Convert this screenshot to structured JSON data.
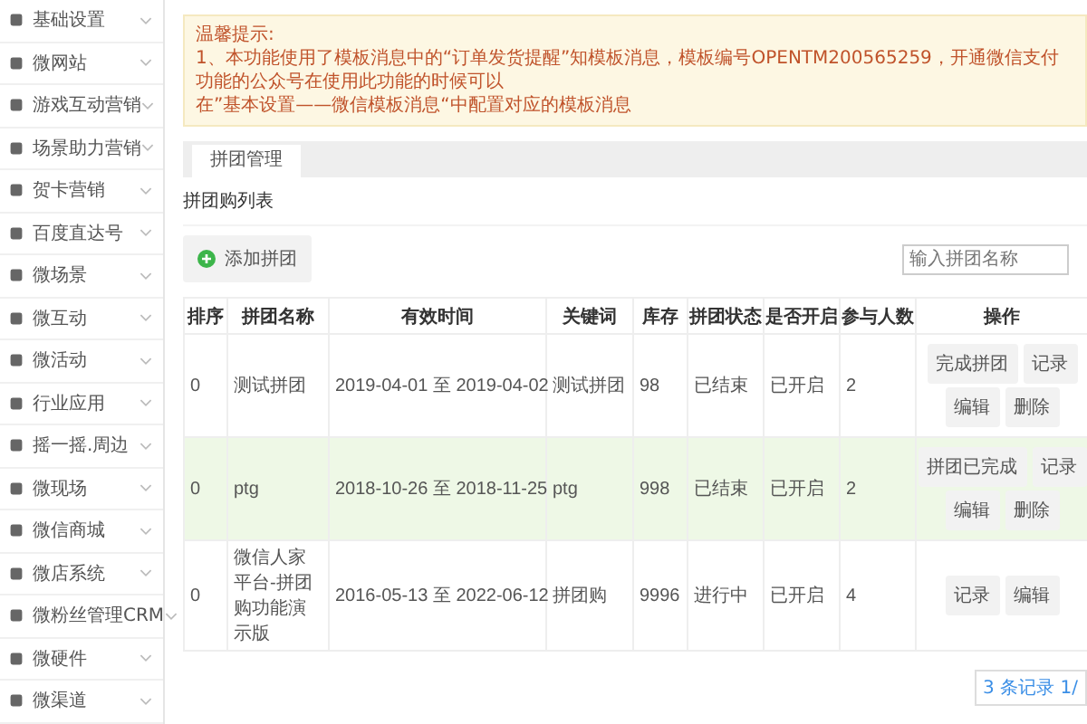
{
  "sidebar": {
    "items": [
      {
        "label": "基础设置"
      },
      {
        "label": "微网站"
      },
      {
        "label": "游戏互动营销"
      },
      {
        "label": "场景助力营销"
      },
      {
        "label": "贺卡营销"
      },
      {
        "label": "百度直达号"
      },
      {
        "label": "微场景"
      },
      {
        "label": "微互动"
      },
      {
        "label": "微活动"
      },
      {
        "label": "行业应用"
      },
      {
        "label": "摇一摇.周边"
      },
      {
        "label": "微现场"
      },
      {
        "label": "微信商城"
      },
      {
        "label": "微店系统"
      },
      {
        "label": "微粉丝管理CRM"
      },
      {
        "label": "微硬件"
      },
      {
        "label": "微渠道"
      }
    ]
  },
  "notice": {
    "title": "温馨提示:",
    "lines": [
      "1、本功能使用了模板消息中的“订单发货提醒”知模板消息，模板编号OPENTM200565259，开通微信支付功能的公众号在使用此功能的时候可以",
      "在”基本设置——微信模板消息“中配置对应的模板消息"
    ]
  },
  "tabs": [
    {
      "label": "拼团管理",
      "selected": true
    }
  ],
  "section_title": "拼团购列表",
  "add_button": "添加拼团",
  "search": {
    "placeholder": "输入拼团名称"
  },
  "table": {
    "columns": [
      "排序",
      "拼团名称",
      "有效时间",
      "关键词",
      "库存",
      "拼团状态",
      "是否开启",
      "参与人数",
      "操作"
    ],
    "rows": [
      {
        "highlighted": false,
        "cells": [
          "0",
          "测试拼团",
          "2019-04-01 至 2019-04-02",
          "测试拼团",
          "98",
          "已结束",
          "已开启",
          "2"
        ],
        "actions": [
          "完成拼团",
          "记录",
          "编辑",
          "删除"
        ]
      },
      {
        "highlighted": true,
        "cells": [
          "0",
          "ptg",
          "2018-10-26 至 2018-11-25",
          "ptg",
          "998",
          "已结束",
          "已开启",
          "2"
        ],
        "actions": [
          "拼团已完成",
          "记录",
          "编辑",
          "删除"
        ]
      },
      {
        "highlighted": false,
        "cells": [
          "0",
          "微信人家平台-拼团购功能演示版",
          "2016-05-13 至 2022-06-12",
          "拼团购",
          "9996",
          "进行中",
          "已开启",
          "4"
        ],
        "actions": [
          "记录",
          "编辑"
        ]
      }
    ]
  },
  "pagination": "3 条记录 1/"
}
